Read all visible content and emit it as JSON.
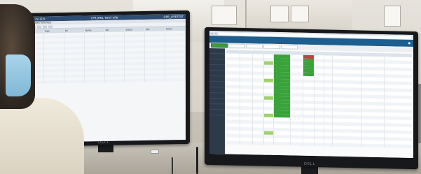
{
  "scene": {
    "description_free": true
  },
  "left_monitor": {
    "brand": "DELL",
    "window_title": "Medis 2V (SP)",
    "window_title_center": "CPR JRNL TEXT VFR",
    "window_title_right": "DPR_LIVESTAT",
    "menu": "File  Edit  View  Tools  Help",
    "columns": [
      "Date",
      "Type",
      "No",
      "Name",
      "Ref",
      "Status",
      "Qty",
      "Notes"
    ],
    "rows": [
      [
        "",
        "",
        "",
        "",
        "",
        "",
        "",
        ""
      ],
      [
        "",
        "",
        "",
        "",
        "",
        "",
        "",
        ""
      ],
      [
        "",
        "",
        "",
        "",
        "",
        "",
        "",
        ""
      ],
      [
        "",
        "",
        "",
        "",
        "",
        "",
        "",
        ""
      ],
      [
        "",
        "",
        "",
        "",
        "",
        "",
        "",
        ""
      ],
      [
        "",
        "",
        "",
        "",
        "",
        "",
        "",
        ""
      ],
      [
        "",
        "",
        "",
        "",
        "",
        "",
        "",
        ""
      ],
      [
        "",
        "",
        "",
        "",
        "",
        "",
        "",
        ""
      ],
      [
        "",
        "",
        "",
        "",
        "",
        "",
        "",
        ""
      ],
      [
        "",
        "",
        "",
        "",
        "",
        "",
        "",
        ""
      ],
      [
        "",
        "",
        "",
        "",
        "",
        "",
        "",
        ""
      ],
      [
        "",
        "",
        "",
        "",
        "",
        "",
        "",
        ""
      ],
      [
        "",
        "",
        "",
        "",
        "",
        "",
        "",
        ""
      ],
      [
        "",
        "",
        "",
        "",
        "",
        "",
        "",
        ""
      ],
      [
        "",
        "",
        "",
        "",
        "",
        "",
        "",
        ""
      ],
      [
        "",
        "",
        "",
        "",
        "",
        "",
        "",
        ""
      ],
      [
        "",
        "",
        "",
        "",
        "",
        "",
        "",
        ""
      ],
      [
        "",
        "",
        "",
        "",
        "",
        "",
        "",
        ""
      ]
    ]
  },
  "right_monitor": {
    "brand": "DELL",
    "url": "",
    "app_title": "",
    "tabs": [
      "",
      "",
      "",
      "",
      ""
    ],
    "sidebar": [
      "",
      "",
      "",
      "",
      "",
      "",
      "",
      "",
      "",
      "",
      "",
      ""
    ],
    "rows": 26
  },
  "colors": {
    "accent_green": "#3aa23a",
    "accent_red": "#c24141",
    "appbar_blue": "#1d5e8f"
  }
}
